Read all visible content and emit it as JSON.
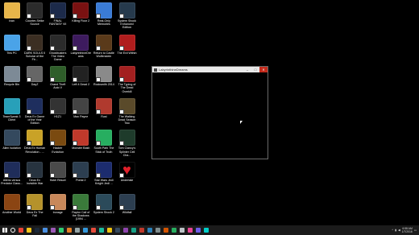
{
  "desktop_icons": [
    {
      "label": "Ivan",
      "color": "#e7b54a",
      "col": 0,
      "row": 0
    },
    {
      "label": "Counter-Strike Source",
      "color": "#2b2b2b",
      "col": 1,
      "row": 0
    },
    {
      "label": "FINAL FANTASY VII",
      "color": "#1c2a4a",
      "col": 2,
      "row": 0
    },
    {
      "label": "Killing Floor 2",
      "color": "#7a1111",
      "col": 3,
      "row": 0
    },
    {
      "label": "Real-Only Memories",
      "color": "#3a7bd5",
      "col": 4,
      "row": 0
    },
    {
      "label": "System Shock Enhanced Edition",
      "color": "#263a4c",
      "col": 5,
      "row": 0
    },
    {
      "label": "This PC",
      "color": "#4aa3e8",
      "col": 0,
      "row": 1
    },
    {
      "label": "DARK SOULS II Scholar of the Fir...",
      "color": "#3b2e22",
      "col": 1,
      "row": 1
    },
    {
      "label": "Ghostbusters The Video Game",
      "color": "#2b2b2b",
      "col": 2,
      "row": 1
    },
    {
      "label": "LabyrinthineDreams",
      "color": "#3d1b5e",
      "col": 3,
      "row": 1
    },
    {
      "label": "Return to Castle Wolfenstein",
      "color": "#5a3a1a",
      "col": 4,
      "row": 1
    },
    {
      "label": "The Evil Within",
      "color": "#b01d1d",
      "col": 5,
      "row": 1
    },
    {
      "label": "Recycle Bin",
      "color": "#7d8a96",
      "col": 0,
      "row": 2
    },
    {
      "label": "DayZ",
      "color": "#666666",
      "col": 1,
      "row": 2
    },
    {
      "label": "Grand Theft Auto V",
      "color": "#2f5e2a",
      "col": 2,
      "row": 2
    },
    {
      "label": "Left 4 Dead 2",
      "color": "#222222",
      "col": 3,
      "row": 2
    },
    {
      "label": "Rocksmith 2014",
      "color": "#8a8a8a",
      "col": 4,
      "row": 2
    },
    {
      "label": "The Typing of The Dead Overkill",
      "color": "#a32020",
      "col": 5,
      "row": 2
    },
    {
      "label": "TeamSpeak 3 Client",
      "color": "#28a0b9",
      "col": 0,
      "row": 3
    },
    {
      "label": "Deus Ex Game of the Year Edition",
      "color": "#1e2e5e",
      "col": 1,
      "row": 3
    },
    {
      "label": "H1Z1",
      "color": "#333333",
      "col": 2,
      "row": 3
    },
    {
      "label": "Max Payne",
      "color": "#444444",
      "col": 3,
      "row": 3
    },
    {
      "label": "Rust",
      "color": "#b03a2e",
      "col": 4,
      "row": 3
    },
    {
      "label": "The Walking Dead Season Two",
      "color": "#5a4a2a",
      "col": 5,
      "row": 3
    },
    {
      "label": "Alien Isolation",
      "color": "#34495e",
      "col": 0,
      "row": 4
    },
    {
      "label": "Deus Ex Human Revolution - ...",
      "color": "#c9a227",
      "col": 1,
      "row": 4
    },
    {
      "label": "Hacker Evolution",
      "color": "#7a4a10",
      "col": 2,
      "row": 4
    },
    {
      "label": "Monster Bash",
      "color": "#c0392b",
      "col": 3,
      "row": 4
    },
    {
      "label": "South Park The Stick of Truth",
      "color": "#27ae60",
      "col": 4,
      "row": 4
    },
    {
      "label": "Tom Clancy's Splinter Cell Cha...",
      "color": "#1e3b2b",
      "col": 5,
      "row": 4
    },
    {
      "label": "Aliens versus Predator Class...",
      "color": "#1f2d5a",
      "col": 0,
      "row": 5
    },
    {
      "label": "Deus Ex Invisible War",
      "color": "#27333f",
      "col": 1,
      "row": 5
    },
    {
      "label": "Hotel Resort",
      "color": "#4a4a4a",
      "col": 2,
      "row": 5
    },
    {
      "label": "Portal 2",
      "color": "#2c3e50",
      "col": 3,
      "row": 5
    },
    {
      "label": "Star Wars Jedi Knight Jedi ...",
      "color": "#1c2c6e",
      "col": 4,
      "row": 5
    },
    {
      "label": "Undertale",
      "color": "#000000",
      "col": 5,
      "row": 5,
      "heart": true
    },
    {
      "label": "Another World",
      "color": "#8b4513",
      "col": 0,
      "row": 6
    },
    {
      "label": "Deus Ex The Fall",
      "color": "#b5922b",
      "col": 1,
      "row": 6
    },
    {
      "label": "Ironage",
      "color": "#c8885a",
      "col": 2,
      "row": 6
    },
    {
      "label": "Raptor Call of the Shadows (1994 ...",
      "color": "#3a7a3a",
      "col": 3,
      "row": 6
    },
    {
      "label": "System Shock 2",
      "color": "#2b4a5a",
      "col": 4,
      "row": 6
    },
    {
      "label": "Wildfall",
      "color": "#2c3e50",
      "col": 5,
      "row": 6
    }
  ],
  "window": {
    "title": "LabyrinthineDreams",
    "minimize_glyph": "–",
    "maximize_glyph": "□",
    "close_glyph": "✕"
  },
  "taskbar": {
    "apps": [
      {
        "icon": "search-icon",
        "color": "#ffffff"
      },
      {
        "icon": "chrome-icon",
        "color": "#e84335"
      },
      {
        "icon": "explorer-icon",
        "color": "#f5c518"
      },
      {
        "icon": "steam-icon",
        "color": "#1b2838"
      },
      {
        "icon": "app-icon",
        "color": "#4a90e2"
      },
      {
        "icon": "app-icon",
        "color": "#9b59b6"
      },
      {
        "icon": "app-icon",
        "color": "#2ecc71"
      },
      {
        "icon": "app-icon",
        "color": "#e67e22"
      },
      {
        "icon": "app-icon",
        "color": "#95a5a6"
      },
      {
        "icon": "app-icon",
        "color": "#3498db"
      },
      {
        "icon": "app-icon",
        "color": "#e74c3c"
      },
      {
        "icon": "app-icon",
        "color": "#1abc9c"
      },
      {
        "icon": "app-icon",
        "color": "#f1c40f"
      },
      {
        "icon": "app-icon",
        "color": "#34495e"
      },
      {
        "icon": "app-icon",
        "color": "#8e44ad"
      },
      {
        "icon": "app-icon",
        "color": "#16a085"
      },
      {
        "icon": "app-icon",
        "color": "#c0392b"
      },
      {
        "icon": "app-icon",
        "color": "#2980b9"
      },
      {
        "icon": "app-icon",
        "color": "#7f8c8d"
      },
      {
        "icon": "app-icon",
        "color": "#d35400"
      },
      {
        "icon": "app-icon",
        "color": "#27ae60"
      },
      {
        "icon": "app-icon",
        "color": "#bdc3c7"
      },
      {
        "icon": "app-icon",
        "color": "#e84393"
      },
      {
        "icon": "app-icon",
        "color": "#6c5ce7"
      },
      {
        "icon": "app-icon",
        "color": "#00cec9"
      }
    ],
    "clock_time": "6:58 AM",
    "clock_date": "1/7/2016"
  }
}
